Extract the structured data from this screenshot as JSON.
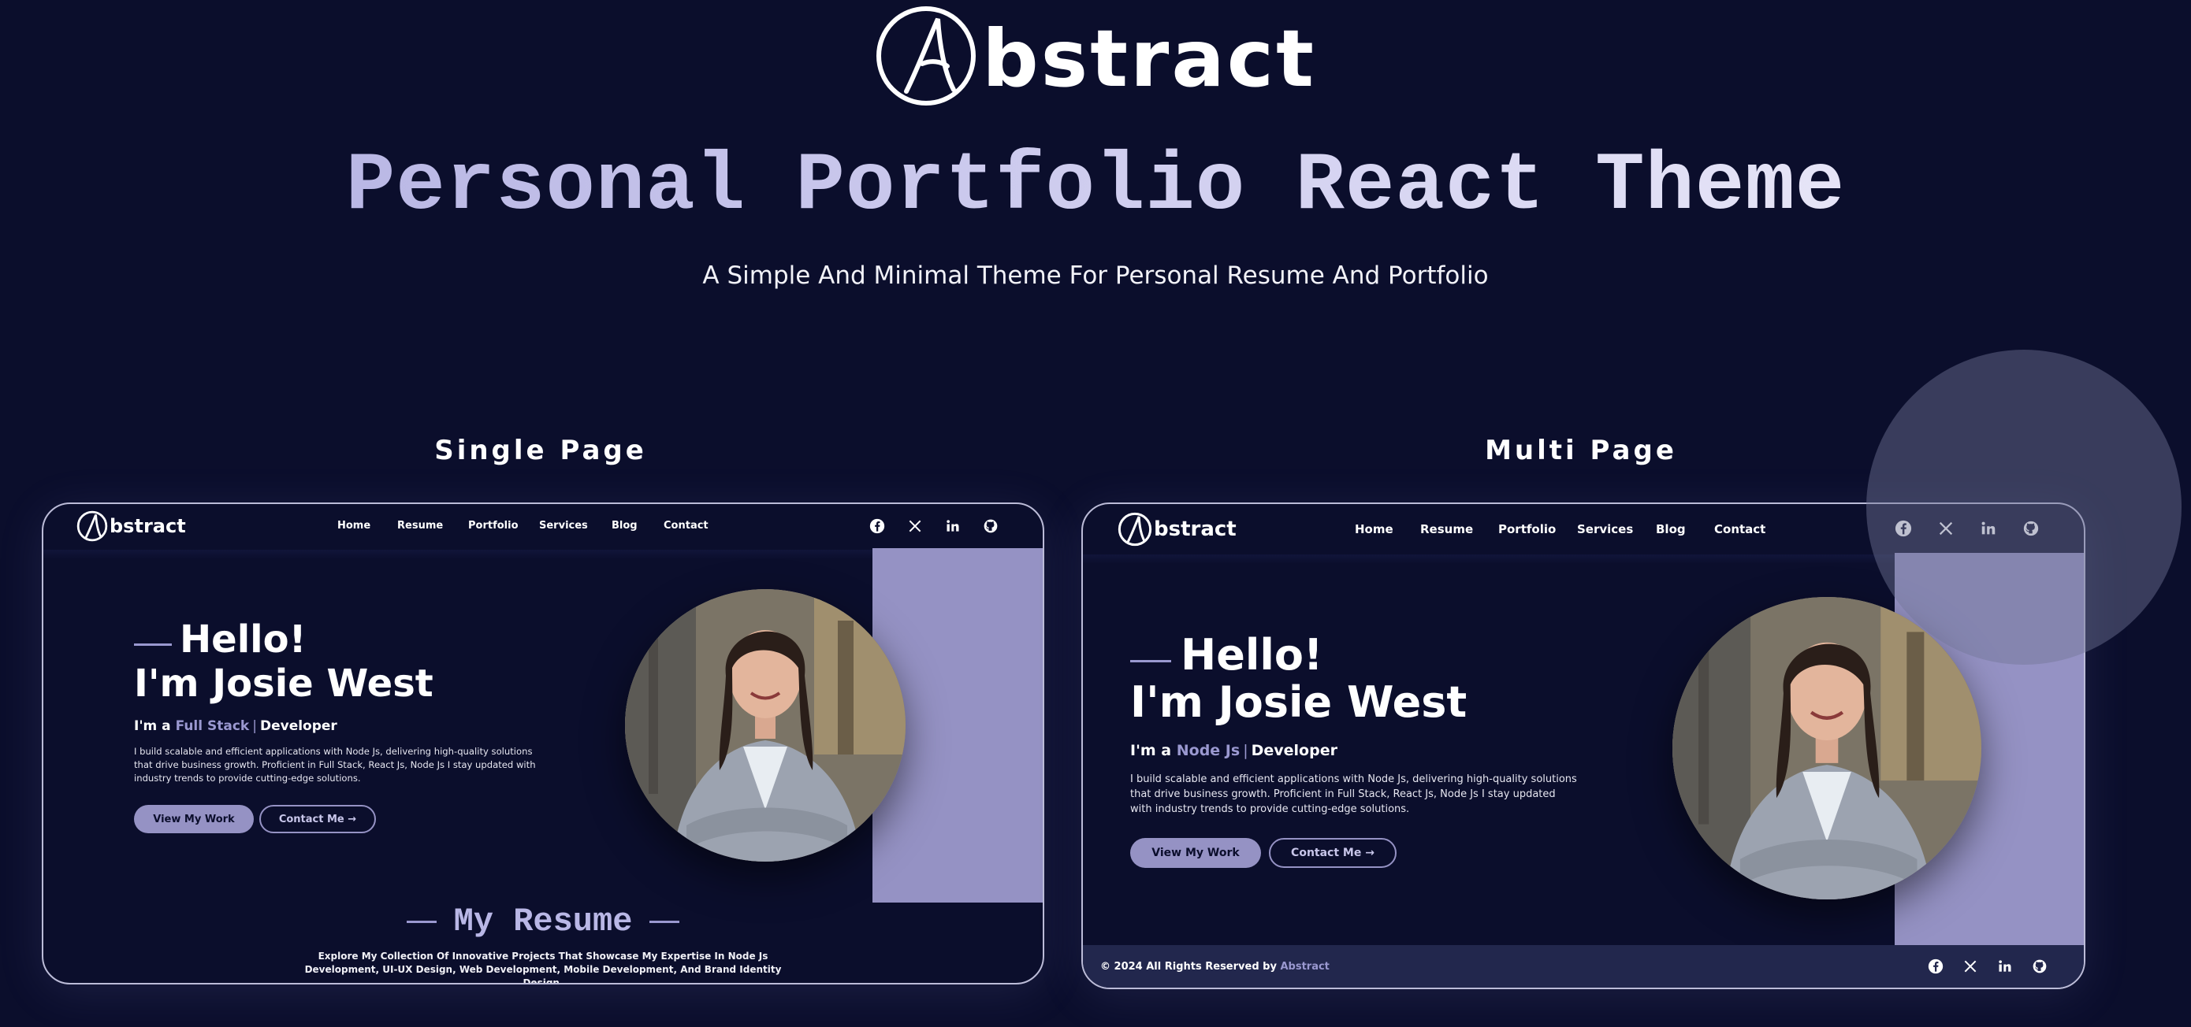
{
  "brand": {
    "word": "bstract",
    "mark_letter": "A"
  },
  "hero": {
    "title": "Personal Portfolio React Theme",
    "subtitle": "A Simple And Minimal Theme For Personal Resume And Portfolio"
  },
  "sections": {
    "single_label": "Single Page",
    "multi_label": "Multi Page"
  },
  "colors": {
    "background": "#0b0e2c",
    "accent": "#9592c4",
    "footer": "#22274d"
  },
  "single": {
    "logo_word": "bstract",
    "nav": [
      "Home",
      "Resume",
      "Portfolio",
      "Services",
      "Blog",
      "Contact"
    ],
    "social_icons": [
      "facebook-icon",
      "x-icon",
      "linkedin-icon",
      "github-icon"
    ],
    "hello": "Hello!",
    "name": "I'm Josie West",
    "role_prefix": "I'm a",
    "role_highlight": "Full Stack",
    "role_sep": "|",
    "role_suffix": "Developer",
    "description": "I build scalable and efficient applications with Node Js, delivering high-quality solutions that drive business growth. Proficient in Full Stack, React Js, Node Js I stay updated with industry trends to provide cutting-edge solutions.",
    "btn_primary": "View My Work",
    "btn_outline": "Contact Me →",
    "resume_title": "My Resume",
    "resume_description": "Explore My Collection Of Innovative Projects That Showcase My Expertise In Node Js Development, UI-UX Design, Web Development, Mobile Development, And Brand Identity Design."
  },
  "multi": {
    "logo_word": "bstract",
    "nav": [
      "Home",
      "Resume",
      "Portfolio",
      "Services",
      "Blog",
      "Contact"
    ],
    "social_icons": [
      "facebook-icon",
      "x-icon",
      "linkedin-icon",
      "github-icon"
    ],
    "hello": "Hello!",
    "name": "I'm Josie West",
    "role_prefix": "I'm a",
    "role_highlight": "Node Js",
    "role_sep": "|",
    "role_suffix": "Developer",
    "description": "I build scalable and efficient applications with Node Js, delivering high-quality solutions that drive business growth. Proficient in Full Stack, React Js, Node Js I stay updated with industry trends to provide cutting-edge solutions.",
    "btn_primary": "View My Work",
    "btn_outline": "Contact Me →",
    "footer_copy": "© 2024 All Rights Reserved by",
    "footer_brand": "Abstract"
  }
}
